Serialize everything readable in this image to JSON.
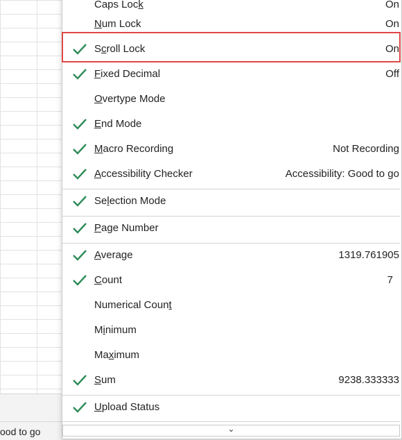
{
  "background": {
    "status_text_partial": "ood to go"
  },
  "menu": {
    "scroll_down_glyph": "⌄",
    "items": [
      {
        "label_pre": "Caps Loc",
        "label_acc": "k",
        "label_post": "",
        "value": "On",
        "checked": false
      },
      {
        "label_pre": "",
        "label_acc": "N",
        "label_post": "um Lock",
        "value": "On",
        "checked": false
      },
      {
        "label_pre": "S",
        "label_acc": "c",
        "label_post": "roll Lock",
        "value": "On",
        "checked": true
      },
      {
        "label_pre": "",
        "label_acc": "F",
        "label_post": "ixed Decimal",
        "value": "Off",
        "checked": true
      },
      {
        "label_pre": "",
        "label_acc": "O",
        "label_post": "vertype Mode",
        "value": "",
        "checked": false
      },
      {
        "label_pre": "",
        "label_acc": "E",
        "label_post": "nd Mode",
        "value": "",
        "checked": true
      },
      {
        "label_pre": "",
        "label_acc": "M",
        "label_post": "acro Recording",
        "value": "Not Recording",
        "checked": true
      },
      {
        "label_pre": "",
        "label_acc": "A",
        "label_post": "ccessibility Checker",
        "value": "Accessibility: Good to go",
        "checked": true
      },
      {
        "label_pre": "Se",
        "label_acc": "l",
        "label_post": "ection Mode",
        "value": "",
        "checked": true
      },
      {
        "label_pre": "",
        "label_acc": "P",
        "label_post": "age Number",
        "value": "",
        "checked": true
      },
      {
        "label_pre": "",
        "label_acc": "A",
        "label_post": "verage",
        "value": "1319.761905",
        "checked": true
      },
      {
        "label_pre": "",
        "label_acc": "C",
        "label_post": "ount",
        "value": "7",
        "checked": true
      },
      {
        "label_pre": "Numerical Coun",
        "label_acc": "t",
        "label_post": "",
        "value": "",
        "checked": false
      },
      {
        "label_pre": "M",
        "label_acc": "i",
        "label_post": "nimum",
        "value": "",
        "checked": false
      },
      {
        "label_pre": "Ma",
        "label_acc": "x",
        "label_post": "imum",
        "value": "",
        "checked": false
      },
      {
        "label_pre": "",
        "label_acc": "S",
        "label_post": "um",
        "value": "9238.333333",
        "checked": true
      },
      {
        "label_pre": "",
        "label_acc": "U",
        "label_post": "pload Status",
        "value": "",
        "checked": true
      }
    ]
  },
  "colors": {
    "check": "#2e8b57",
    "highlight": "#e04646"
  }
}
